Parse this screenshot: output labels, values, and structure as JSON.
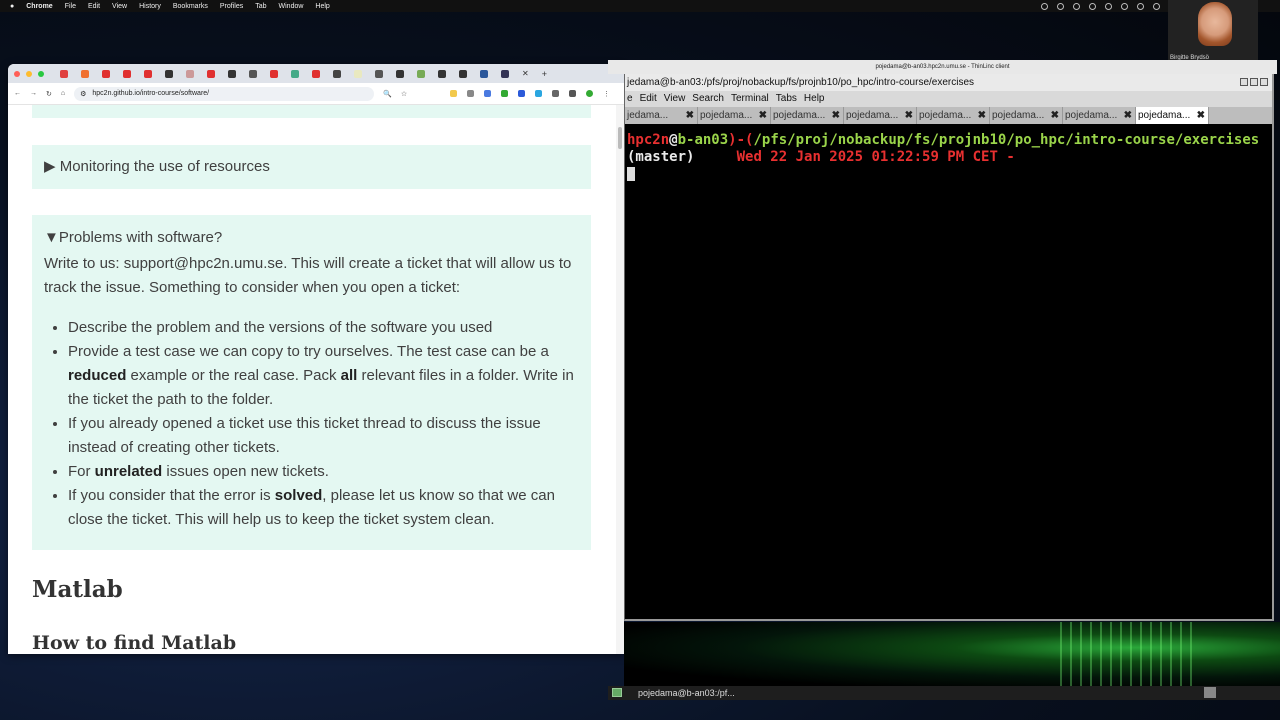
{
  "menubar": {
    "app": "Chrome",
    "items": [
      "File",
      "Edit",
      "View",
      "History",
      "Bookmarks",
      "Profiles",
      "Tab",
      "Window",
      "Help"
    ]
  },
  "webcam": {
    "name": "Birgitte Brydsö"
  },
  "browser": {
    "url": "hpc2n.github.io/intro-course/software/",
    "accent": "#e4f8f2"
  },
  "page": {
    "monitoring_summary": "▶ Monitoring the use of resources",
    "problems_summary": "▼Problems with software?",
    "problems_intro": "Write to us: support@hpc2n.umu.se. This will create a ticket that will allow us to track the issue. Something to consider when you open a ticket:",
    "bullets": [
      {
        "pre": "Describe the problem and the versions of the software you used",
        "b": "",
        "post": "",
        "b2": "",
        "post2": ""
      },
      {
        "pre": "Provide a test case we can copy to try ourselves. The test case can be a ",
        "b": "reduced",
        "post": " example or the real case. Pack ",
        "b2": "all",
        "post2": " relevant files in a folder. Write in the ticket the path to the folder."
      },
      {
        "pre": "If you already opened a ticket use this ticket thread to discuss the issue instead of creating other tickets.",
        "b": "",
        "post": "",
        "b2": "",
        "post2": ""
      },
      {
        "pre": "For ",
        "b": "unrelated",
        "post": " issues open new tickets.",
        "b2": "",
        "post2": ""
      },
      {
        "pre": "If you consider that the error is ",
        "b": "solved",
        "post": ", please let us know so that we can close the ticket. This will help us to keep the ticket system clean.",
        "b2": "",
        "post2": ""
      }
    ],
    "heading_matlab": "Matlab",
    "heading_find": "How to find Matlab"
  },
  "thinlinc": {
    "title": "pojedama@b-an03.hpc2n.umu.se - ThinLinc client"
  },
  "terminal": {
    "title": "jedama@b-an03:/pfs/proj/nobackup/fs/projnb10/po_hpc/intro-course/exercises",
    "menu": [
      "e",
      "Edit",
      "View",
      "Search",
      "Terminal",
      "Tabs",
      "Help"
    ],
    "tabs": [
      "jedama...",
      "pojedama...",
      "pojedama...",
      "pojedama...",
      "pojedama...",
      "pojedama...",
      "pojedama...",
      "pojedama..."
    ],
    "prompt_user": "hpc2n",
    "prompt_at": "@",
    "prompt_host": "b-an03",
    "prompt_sep": ")-(",
    "prompt_path": "/pfs/proj/nobackup/fs/projnb10/po_hpc/intro-course/exercises",
    "branch": "(master)",
    "datetime": "Wed 22 Jan 2025 01:22:59 PM CET -"
  },
  "taskbar": {
    "item": "pojedama@b-an03:/pf..."
  }
}
